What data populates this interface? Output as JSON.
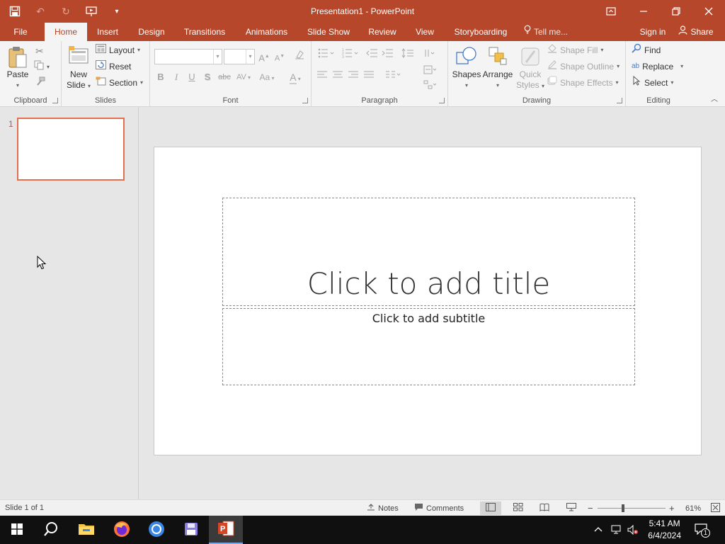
{
  "app": {
    "window_title": "Presentation1 - PowerPoint",
    "accent_color": "#b7472a"
  },
  "tabs": [
    {
      "label": "File"
    },
    {
      "label": "Home"
    },
    {
      "label": "Insert"
    },
    {
      "label": "Design"
    },
    {
      "label": "Transitions"
    },
    {
      "label": "Animations"
    },
    {
      "label": "Slide Show"
    },
    {
      "label": "Review"
    },
    {
      "label": "View"
    },
    {
      "label": "Storyboarding"
    }
  ],
  "tell_me": "Tell me...",
  "sign_in": "Sign in",
  "share": "Share",
  "ribbon": {
    "clipboard": {
      "label": "Clipboard",
      "paste": "Paste"
    },
    "slides": {
      "label": "Slides",
      "new_slide_1": "New",
      "new_slide_2": "Slide",
      "layout": "Layout",
      "reset": "Reset",
      "section": "Section"
    },
    "font": {
      "label": "Font",
      "bold": "B",
      "italic": "I",
      "underline": "U",
      "shadow": "S",
      "strike": "abc",
      "spacing": "AV",
      "case": "Aa",
      "grow": "A",
      "shrink": "A"
    },
    "paragraph": {
      "label": "Paragraph"
    },
    "drawing": {
      "label": "Drawing",
      "shapes": "Shapes",
      "arrange": "Arrange",
      "quick_1": "Quick",
      "quick_2": "Styles",
      "shape_fill": "Shape Fill",
      "shape_outline": "Shape Outline",
      "shape_effects": "Shape Effects"
    },
    "editing": {
      "label": "Editing",
      "find": "Find",
      "replace": "Replace",
      "select": "Select",
      "replace_icon": "ab"
    }
  },
  "thumbnails": [
    {
      "number": "1"
    }
  ],
  "slide": {
    "title_placeholder": "Click to add title",
    "subtitle_placeholder": "Click to add subtitle"
  },
  "status": {
    "slide_info": "Slide 1 of 1",
    "notes": "Notes",
    "comments": "Comments",
    "zoom": "61%",
    "zoom_fraction": 0.38
  },
  "taskbar": {
    "time": "5:41 AM",
    "date": "6/4/2024",
    "notification_count": "1"
  }
}
